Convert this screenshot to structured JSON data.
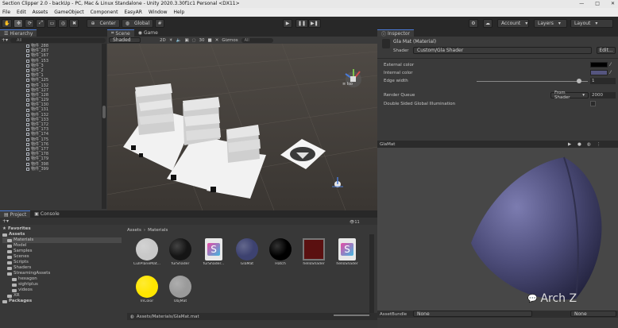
{
  "window": {
    "title": "Section Clipper 2.0 - backUp - PC, Mac & Linux Standalone - Unity 2020.3.30f1c1 Personal <DX11>",
    "controls": [
      "—",
      "□",
      "✕"
    ]
  },
  "menu": [
    "File",
    "Edit",
    "Assets",
    "GameObject",
    "Component",
    "EasyAR",
    "Window",
    "Help"
  ],
  "toolbar": {
    "pivot": "Center",
    "space": "Global",
    "account": "Account",
    "layers": "Layers",
    "layout": "Layout"
  },
  "hierarchy": {
    "tab": "Hierarchy",
    "search": "All",
    "items": [
      "物件_288",
      "物件_287",
      "物件_167",
      "物件_153",
      "物件_3",
      "物件_2",
      "物件_1",
      "物件_125",
      "物件_132",
      "物件_127",
      "物件_128",
      "物件_129",
      "物件_130",
      "物件_131",
      "物件_132",
      "物件_133",
      "物件_172",
      "物件_173",
      "物件_174",
      "物件_175",
      "物件_176",
      "物件_177",
      "物件_178",
      "物件_179",
      "物件_398",
      "物件_399"
    ]
  },
  "scene": {
    "tabs": [
      "Scene",
      "Game"
    ],
    "shading": "Shaded",
    "mode2d": "2D",
    "gizmos": "Gizmos",
    "search": "All",
    "iso": "≡ Iso",
    "marker_count": "30"
  },
  "project": {
    "tabs": [
      "Project",
      "Console"
    ],
    "tree": [
      {
        "label": "Favorites",
        "level": 0,
        "bold": true
      },
      {
        "label": "Assets",
        "level": 0,
        "bold": true
      },
      {
        "label": "Materials",
        "level": 1,
        "selected": true
      },
      {
        "label": "Model",
        "level": 1
      },
      {
        "label": "Samples",
        "level": 1
      },
      {
        "label": "Scenes",
        "level": 1
      },
      {
        "label": "Scripts",
        "level": 1
      },
      {
        "label": "Shaders",
        "level": 1
      },
      {
        "label": "StreamingAssets",
        "level": 1
      },
      {
        "label": "hexagon",
        "level": 2
      },
      {
        "label": "sightplus",
        "level": 2
      },
      {
        "label": "videos",
        "level": 2
      },
      {
        "label": "XR",
        "level": 1
      },
      {
        "label": "Packages",
        "level": 0,
        "bold": true
      }
    ],
    "breadcrumb": [
      "Assets",
      "Materials"
    ],
    "count": "11",
    "assets": [
      {
        "name": "CullPlaneMat...",
        "kind": "sphere-light"
      },
      {
        "name": "furShader",
        "kind": "sphere-dark"
      },
      {
        "name": "furShader...",
        "kind": "shader"
      },
      {
        "name": "GlaMat",
        "kind": "sphere-blue"
      },
      {
        "name": "Hatch",
        "kind": "sphere-black"
      },
      {
        "name": "helloShader",
        "kind": "square-red"
      },
      {
        "name": "helloShader",
        "kind": "shader"
      },
      {
        "name": "InColor",
        "kind": "sphere-yellow"
      },
      {
        "name": "ObjMat",
        "kind": "sphere-grey"
      }
    ],
    "status_path": "Assets/Materials/GlaMat.mat"
  },
  "inspector": {
    "tab": "Inspector",
    "material_name": "Gla Mat (Material)",
    "shader_label": "Shader",
    "shader_value": "Custom/Gla Shader",
    "edit": "Edit...",
    "props": [
      {
        "label": "External color",
        "type": "color",
        "value": "#000000"
      },
      {
        "label": "Internal color",
        "type": "color",
        "value": "#55557f"
      },
      {
        "label": "Edge width",
        "type": "slider",
        "value": "1",
        "fraction": 0.92
      },
      {
        "label": "Render Queue",
        "type": "queue",
        "option": "From Shader",
        "value": "2000"
      },
      {
        "label": "Double Sided Global Illumination",
        "type": "check"
      }
    ],
    "preview_title": "GlaMat",
    "assetbundle_label": "AssetBundle",
    "assetbundle_value": "None",
    "assetbundle_variant": "None"
  },
  "watermark": "Arch Z"
}
